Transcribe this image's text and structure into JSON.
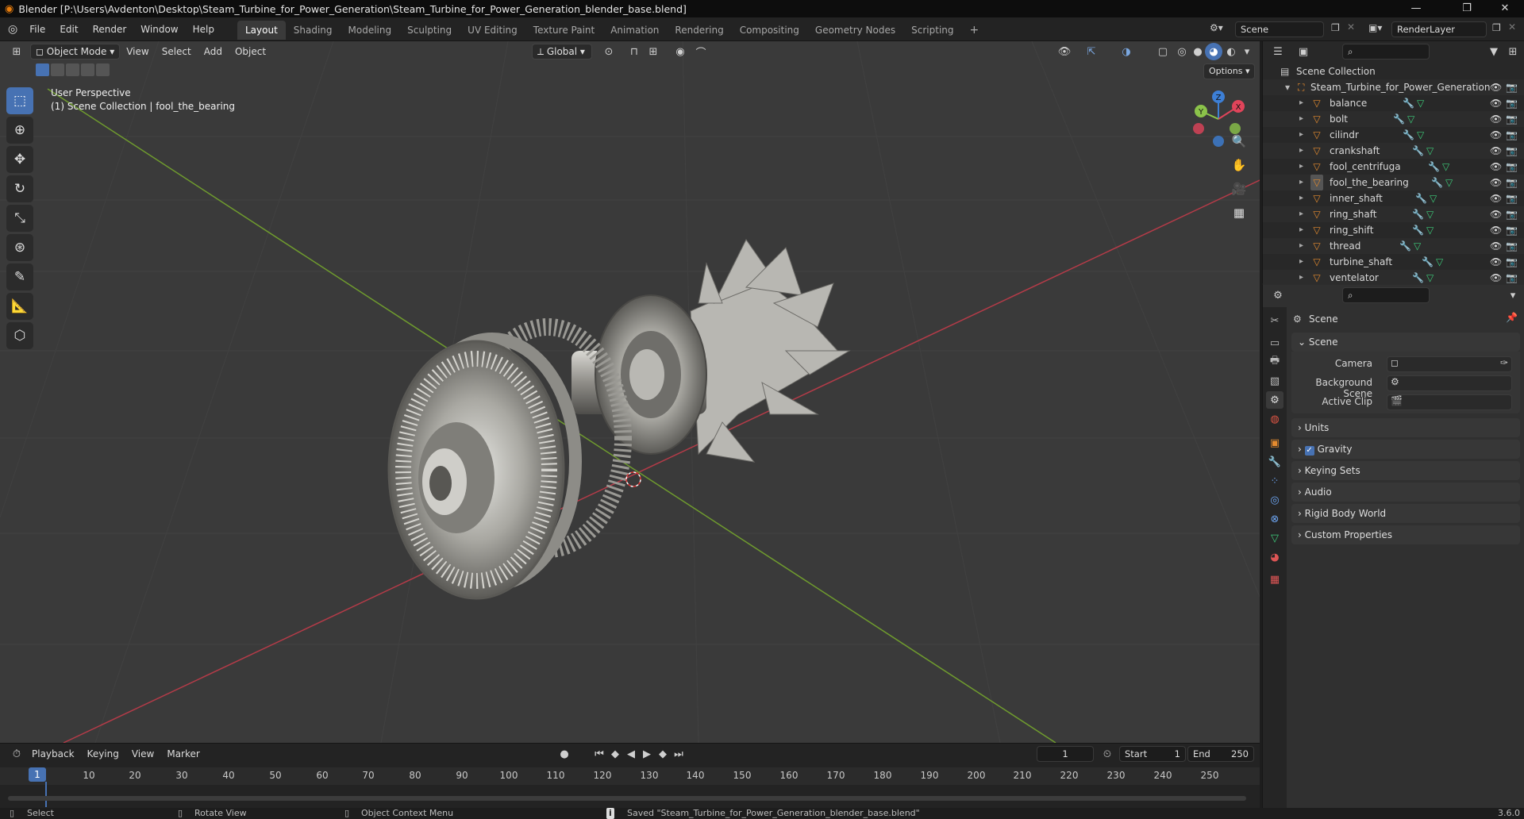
{
  "window": {
    "title": "Blender [P:\\Users\\Avdenton\\Desktop\\Steam_Turbine_for_Power_Generation\\Steam_Turbine_for_Power_Generation_blender_base.blend]",
    "controls": [
      "—",
      "❐",
      "✕"
    ]
  },
  "menu": [
    "File",
    "Edit",
    "Render",
    "Window",
    "Help"
  ],
  "workspaces": [
    "Layout",
    "Shading",
    "Modeling",
    "Sculpting",
    "UV Editing",
    "Texture Paint",
    "Animation",
    "Rendering",
    "Compositing",
    "Geometry Nodes",
    "Scripting",
    "+"
  ],
  "active_workspace": "Layout",
  "scene_selector": "Scene",
  "view_layer": "RenderLayer",
  "viewport": {
    "mode": "Object Mode",
    "menus": [
      "View",
      "Select",
      "Add",
      "Object"
    ],
    "transform_orientation": "Global",
    "options": "Options",
    "overlay_line1": "User Perspective",
    "overlay_line2": "(1) Scene Collection | fool_the_bearing",
    "gizmo_axes": {
      "x": "X",
      "y": "Y",
      "z": "Z"
    }
  },
  "timeline": {
    "menus": [
      "Playback",
      "Keying",
      "View",
      "Marker"
    ],
    "current_frame": "1",
    "start_label": "Start",
    "start": "1",
    "end_label": "End",
    "end": "250",
    "ticks": [
      "1",
      "10",
      "20",
      "30",
      "40",
      "50",
      "60",
      "70",
      "80",
      "90",
      "100",
      "110",
      "120",
      "130",
      "140",
      "150",
      "160",
      "170",
      "180",
      "190",
      "200",
      "210",
      "220",
      "230",
      "240",
      "250"
    ]
  },
  "statusbar": {
    "select": "Select",
    "rotate": "Rotate View",
    "context": "Object Context Menu",
    "message": "Saved \"Steam_Turbine_for_Power_Generation_blender_base.blend\"",
    "version": "3.6.0"
  },
  "outliner": {
    "root": "Scene Collection",
    "collection": "Steam_Turbine_for_Power_Generation",
    "objects": [
      "balance",
      "bolt",
      "cilindr",
      "crankshaft",
      "fool_centrifuga",
      "fool_the_bearing",
      "inner_shaft",
      "ring_shaft",
      "ring_shift",
      "thread",
      "turbine_shaft",
      "ventelator"
    ]
  },
  "properties": {
    "context": "Scene",
    "panel_scene": "Scene",
    "camera_label": "Camera",
    "background_label": "Background Scene",
    "clip_label": "Active Clip",
    "panels": [
      "Units",
      "Gravity",
      "Keying Sets",
      "Audio",
      "Rigid Body World",
      "Custom Properties"
    ]
  },
  "colors": {
    "accent": "#4772b3",
    "x_axis": "#e0445a",
    "y_axis": "#8bc34a",
    "z_axis": "#3d7fd6",
    "object_icon": "#e48b2f"
  }
}
